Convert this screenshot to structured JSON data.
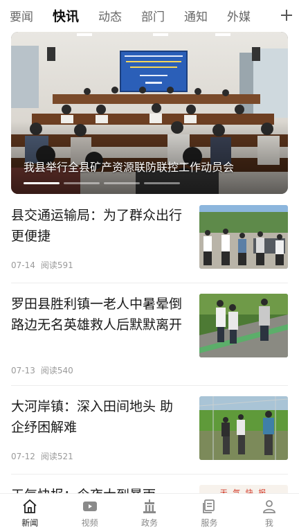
{
  "top_tabs": [
    {
      "label": "要闻",
      "active": false
    },
    {
      "label": "快讯",
      "active": true
    },
    {
      "label": "动态",
      "active": false
    },
    {
      "label": "部门",
      "active": false
    },
    {
      "label": "通知",
      "active": false
    },
    {
      "label": "外媒",
      "active": false
    }
  ],
  "add_tab_icon": "plus-icon",
  "banner": {
    "caption": "我县举行全县矿产资源联防联控工作动员会",
    "screen_title": "罗田县开展“出来秘书进企业服务优化营商助推发展环境”活动动员会",
    "screen_date": "2023年6月14日",
    "dots_count": 4,
    "active_dot": 0
  },
  "news": [
    {
      "title": "县交通运输局：为了群众出行更便捷",
      "date": "07-14",
      "reads": "阅读591"
    },
    {
      "title": "罗田县胜利镇一老人中暑晕倒路边无名英雄救人后默默离开",
      "date": "07-13",
      "reads": "阅读540"
    },
    {
      "title": "大河岸镇：深入田间地头 助企纾困解难",
      "date": "07-12",
      "reads": "阅读521"
    },
    {
      "title": "天气快报：今夜大到暴雨",
      "thumb_text": "天 气 快 报"
    }
  ],
  "bottom_nav": [
    {
      "label": "新闻",
      "icon": "home-icon",
      "active": true
    },
    {
      "label": "视频",
      "icon": "video-icon",
      "active": false
    },
    {
      "label": "政务",
      "icon": "government-building-icon",
      "active": false
    },
    {
      "label": "服务",
      "icon": "service-icon",
      "active": false
    },
    {
      "label": "我",
      "icon": "user-icon",
      "active": false
    }
  ],
  "colors": {
    "accent": "#111111",
    "muted": "#9a9a9a",
    "screen_blue": "#2b5fb8"
  }
}
